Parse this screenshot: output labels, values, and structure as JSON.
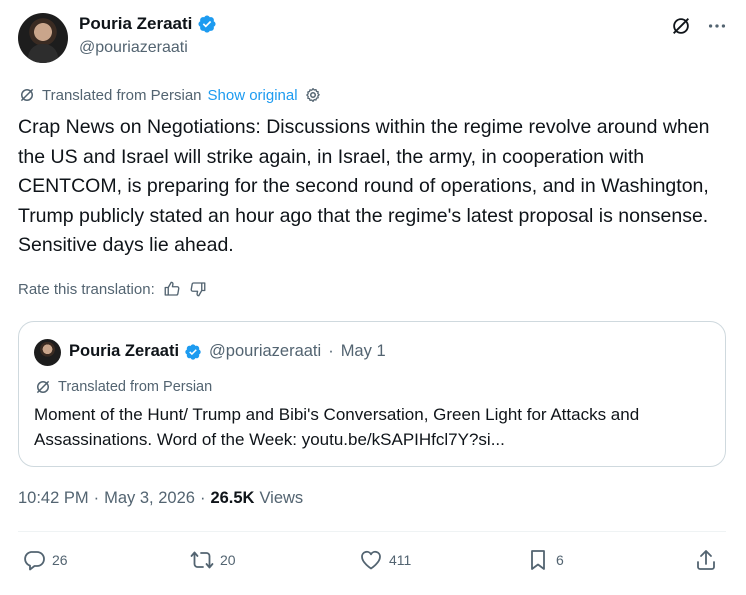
{
  "author": {
    "name": "Pouria Zeraati",
    "handle": "@pouriazeraati"
  },
  "translation": {
    "note": "Translated from Persian",
    "show_original": "Show original"
  },
  "tweet_text": "Crap News on Negotiations: Discussions within the regime revolve around when the US and Israel will strike again, in Israel, the army, in cooperation with CENTCOM, is preparing for the second round of operations, and in Washington, Trump publicly stated an hour ago that the regime's latest proposal is nonsense. Sensitive days lie ahead.",
  "rate_label": "Rate this translation:",
  "quote": {
    "name": "Pouria Zeraati",
    "handle": "@pouriazeraati",
    "separator": "·",
    "date": "May 1",
    "translated_note": "Translated from Persian",
    "text": "Moment of the Hunt/ Trump and Bibi's Conversation, Green Light for Attacks and Assassinations. Word of the Week: youtu.be/kSAPIHfcl7Y?si..."
  },
  "meta": {
    "time": "10:42 PM",
    "sep1": "·",
    "date": "May 3, 2026",
    "sep2": "·",
    "views_count": "26.5K",
    "views_label": "Views"
  },
  "actions": {
    "replies": "26",
    "reposts": "20",
    "likes": "411",
    "bookmarks": "6"
  },
  "colors": {
    "accent": "#1d9bf0",
    "secondary_text": "#536471",
    "border": "#cfd9de"
  }
}
